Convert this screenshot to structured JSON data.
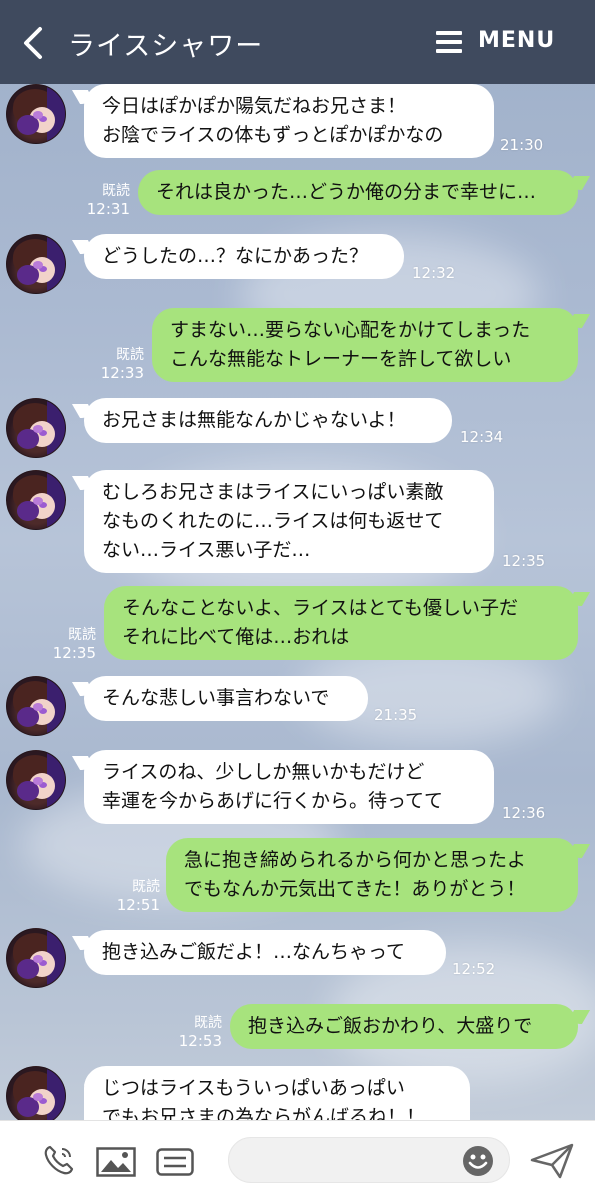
{
  "header": {
    "back_icon": "chevron-left-icon",
    "title": "ライスシャワー",
    "menu_icon": "hamburger-icon",
    "menu_label": "MENU"
  },
  "messages": [
    {
      "side": "in",
      "text": "今日はぽかぽか陽気だねお兄さま！\nお陰でライスの体もずっとぽかぽかなの",
      "time": "21:30"
    },
    {
      "side": "out",
      "text": "それは良かった…どうか俺の分まで幸せに…",
      "read": "既読",
      "time": "12:31"
    },
    {
      "side": "in",
      "text": "どうしたの…？なにかあった？",
      "time": "12:32"
    },
    {
      "side": "out",
      "text": "すまない…要らない心配をかけてしまった\nこんな無能なトレーナーを許して欲しい",
      "read": "既読",
      "time": "12:33"
    },
    {
      "side": "in",
      "text": "お兄さまは無能なんかじゃないよ！",
      "time": "12:34"
    },
    {
      "side": "in",
      "text": "むしろお兄さまはライスにいっぱい素敵\nなものくれたのに…ライスは何も返せて\nない…ライス悪い子だ…",
      "time": "12:35"
    },
    {
      "side": "out",
      "text": "そんなことないよ、ライスはとても優しい子だ\nそれに比べて俺は…おれは",
      "read": "既読",
      "time": "12:35"
    },
    {
      "side": "in",
      "text": "そんな悲しい事言わないで",
      "time": "21:35"
    },
    {
      "side": "in",
      "text": "ライスのね、少ししか無いかもだけど\n幸運を今からあげに行くから。待ってて",
      "time": "12:36"
    },
    {
      "side": "out",
      "text": "急に抱き締められるから何かと思ったよ\nでもなんか元気出てきた！ありがとう！",
      "read": "既読",
      "time": "12:51"
    },
    {
      "side": "in",
      "text": "抱き込みご飯だよ！…なんちゃって",
      "time": "12:52"
    },
    {
      "side": "out",
      "text": "抱き込みご飯おかわり、大盛りで",
      "read": "既読",
      "time": "12:53"
    },
    {
      "side": "in",
      "text": "じつはライスもういっぱいあっぱい\nでもお兄さまの為ならがんばるね！！",
      "time": ""
    }
  ],
  "bottom_bar": {
    "call_icon": "phone-icon",
    "image_icon": "image-icon",
    "keyboard_icon": "keyboard-icon",
    "input_placeholder": "",
    "smile_icon": "smile-icon",
    "send_icon": "send-icon"
  },
  "colors": {
    "header_bg": "#3f4a5e",
    "incoming_bubble": "#ffffff",
    "outgoing_bubble": "#a7e37d"
  }
}
